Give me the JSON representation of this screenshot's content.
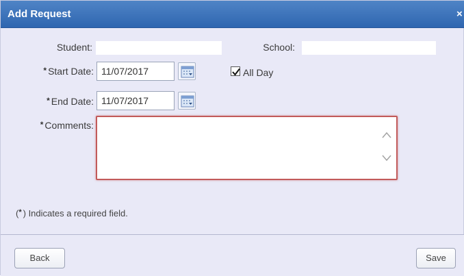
{
  "dialog": {
    "title": "Add Request",
    "close_glyph": "×"
  },
  "form": {
    "student_label": "Student:",
    "school_label": "School:",
    "start_date_label": "Start Date:",
    "start_date_value": "11/07/2017",
    "all_day_label": "All Day",
    "all_day_checked": true,
    "end_date_label": "End Date:",
    "end_date_value": "11/07/2017",
    "comments_label": "Comments:",
    "required_mark": "*"
  },
  "note": {
    "prefix": "(",
    "star": "*",
    "suffix": ") Indicates a required field."
  },
  "footer": {
    "back_label": "Back",
    "save_label": "Save"
  },
  "icons": {
    "calendar": "calendar-icon",
    "checkbox": "checkmark-icon",
    "scroll_up": "chevron-up-icon",
    "scroll_down": "chevron-down-icon"
  },
  "colors": {
    "titlebar": "#3a72bb",
    "dialog_bg": "#e9e9f7",
    "invalid_border": "#c25a5a"
  }
}
